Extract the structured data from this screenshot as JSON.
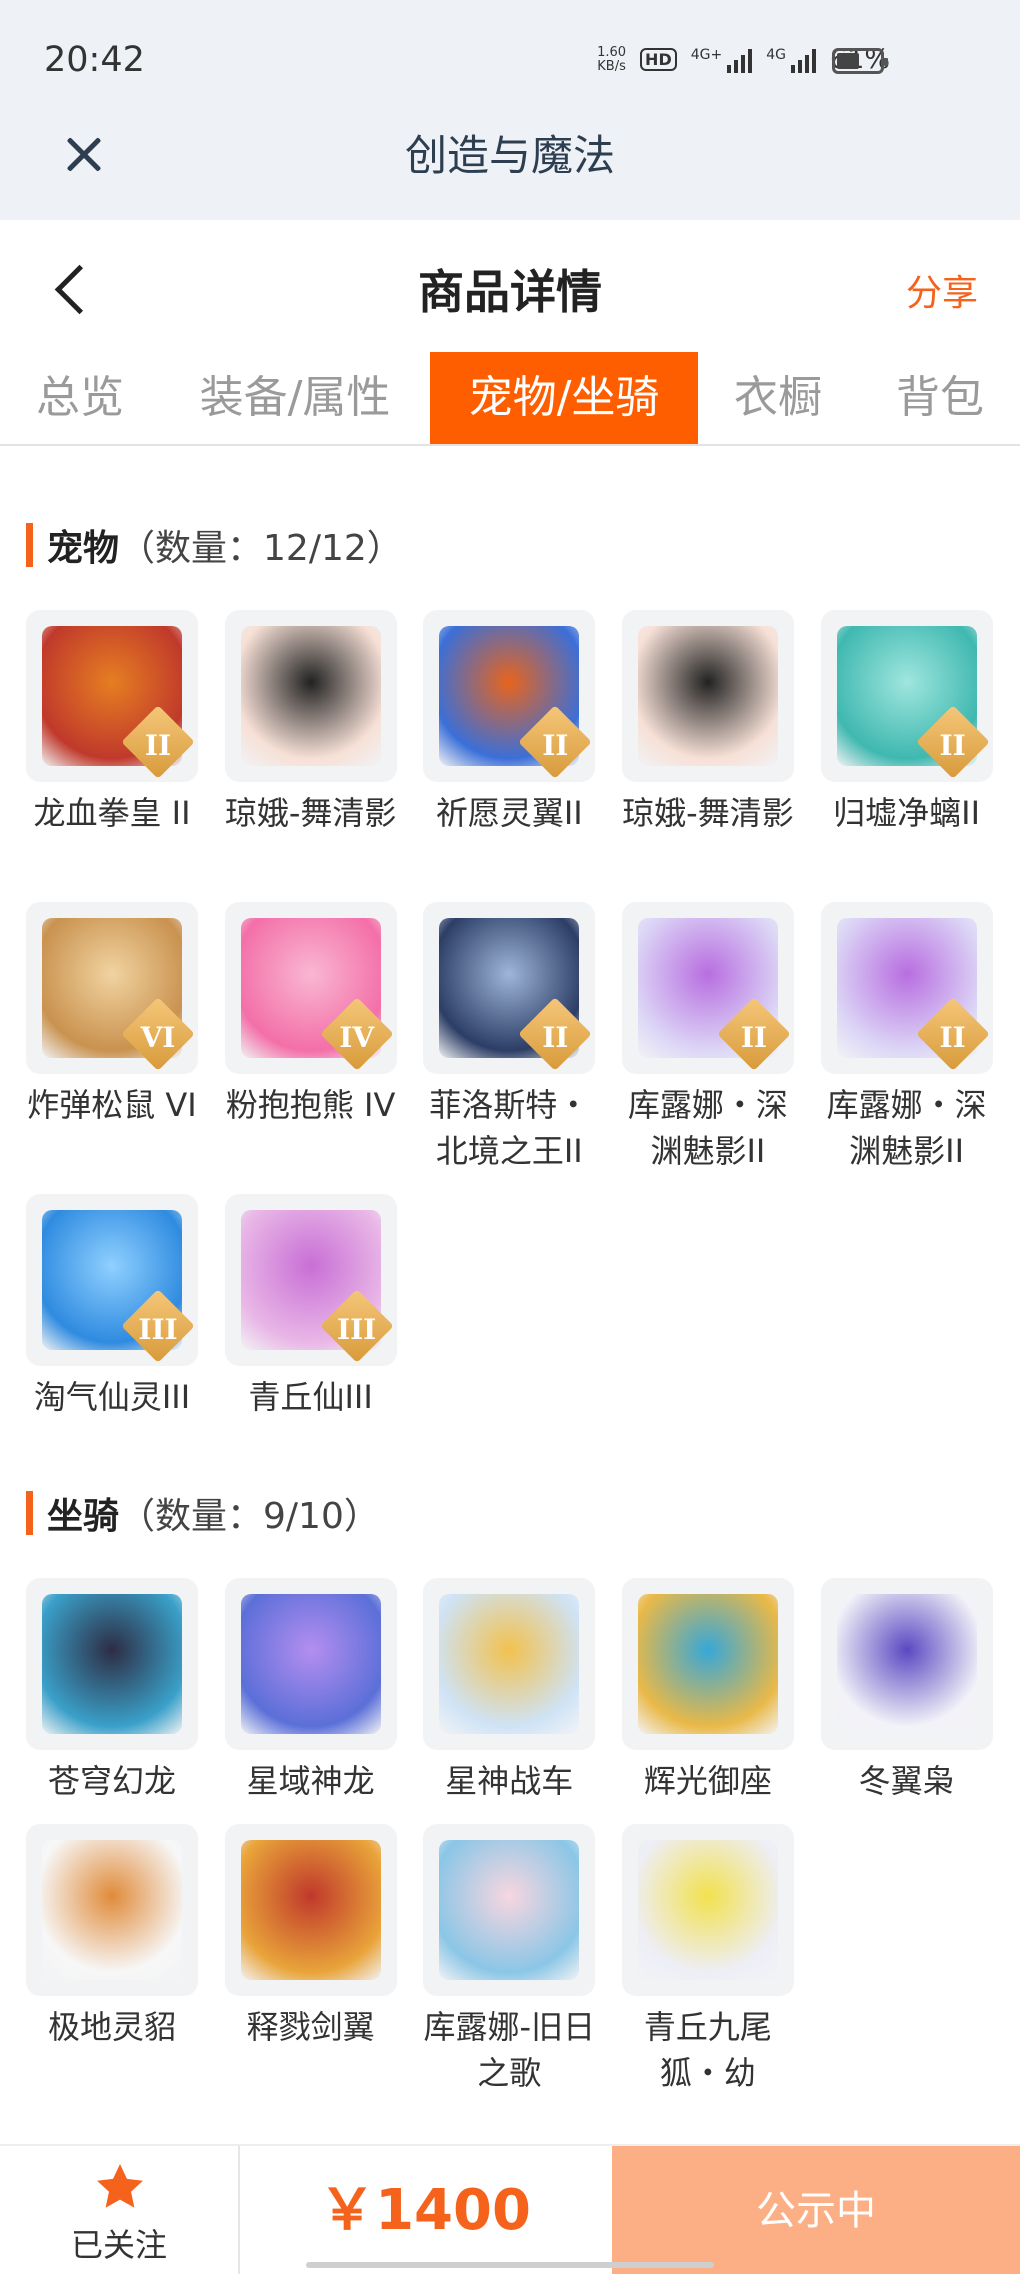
{
  "status_bar": {
    "time": "20:42",
    "net_speed_value": "1.60",
    "net_speed_unit": "KB/s",
    "hd_label": "HD",
    "sim1_label": "4G+",
    "sim2_label": "4G",
    "battery": "61%"
  },
  "app_bar": {
    "title": "创造与魔法"
  },
  "header": {
    "title": "商品详情",
    "share_label": "分享"
  },
  "tabs": [
    {
      "label": "总览"
    },
    {
      "label": "装备/属性"
    },
    {
      "label": "宠物/坐骑"
    },
    {
      "label": "衣橱"
    },
    {
      "label": "背包"
    }
  ],
  "active_tab": "宠物/坐骑",
  "pets": {
    "title": "宠物",
    "count_text": "（数量：12/12）",
    "items": [
      {
        "name": "龙血拳皇 II",
        "badge": "II",
        "icon": "red-dragon-boxer"
      },
      {
        "name": "琼娥-舞清影",
        "badge": "",
        "icon": "chang-e-dancer"
      },
      {
        "name": "祈愿灵翼II",
        "badge": "II",
        "icon": "phoenix-bird"
      },
      {
        "name": "琼娥-舞清影",
        "badge": "",
        "icon": "chang-e-dancer"
      },
      {
        "name": "归墟净螭II",
        "badge": "II",
        "icon": "teal-dragon"
      },
      {
        "name": "炸弹松鼠 VI",
        "badge": "VI",
        "icon": "bomb-squirrel"
      },
      {
        "name": "粉抱抱熊 IV",
        "badge": "IV",
        "icon": "pink-bear"
      },
      {
        "name": "菲洛斯特・北境之王II",
        "badge": "II",
        "icon": "north-king"
      },
      {
        "name": "库露娜・深渊魅影II",
        "badge": "II",
        "icon": "kuluna-abyss"
      },
      {
        "name": "库露娜・深渊魅影II",
        "badge": "II",
        "icon": "kuluna-abyss"
      },
      {
        "name": "淘气仙灵III",
        "badge": "III",
        "icon": "blue-puppy"
      },
      {
        "name": "青丘仙III",
        "badge": "III",
        "icon": "fox-fairy"
      }
    ]
  },
  "mounts": {
    "title": "坐骑",
    "count_text": "（数量：9/10）",
    "items": [
      {
        "name": "苍穹幻龙",
        "icon": "sky-dragon"
      },
      {
        "name": "星域神龙",
        "icon": "star-dragon"
      },
      {
        "name": "星神战车",
        "icon": "star-chariot"
      },
      {
        "name": "辉光御座",
        "icon": "golden-throne"
      },
      {
        "name": "冬翼枭",
        "icon": "snow-owl"
      },
      {
        "name": "极地灵貂",
        "icon": "polar-ferret"
      },
      {
        "name": "释戮剑翼",
        "icon": "sword-wings"
      },
      {
        "name": "库露娜-旧日之歌",
        "icon": "kuluna-song"
      },
      {
        "name": "青丘九尾狐・幼",
        "icon": "nine-tail-fox"
      }
    ]
  },
  "bottom_bar": {
    "follow_label": "已关注",
    "price": "￥1400",
    "status_label": "公示中"
  },
  "colors": {
    "accent": "#ff5e00",
    "share": "#f5621c",
    "status_button": "#fcae84",
    "star": "#f5621c"
  }
}
